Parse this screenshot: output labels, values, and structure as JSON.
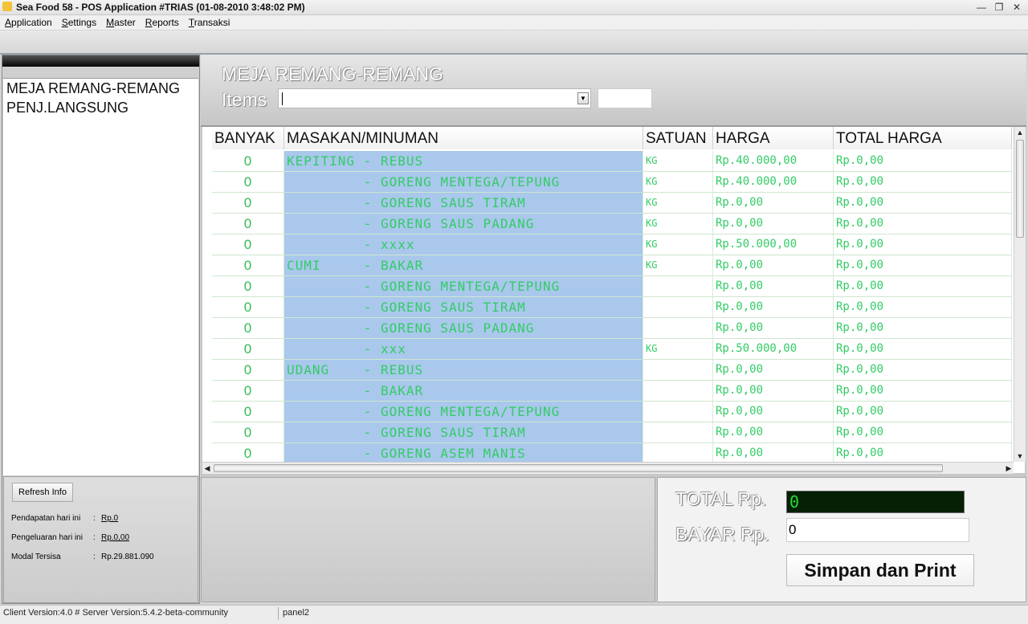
{
  "window": {
    "title": "Sea Food 58 - POS Application #TRIAS (01-08-2010 3:48:02 PM)"
  },
  "menu": [
    "Application",
    "Settings",
    "Master",
    "Reports",
    "Transaksi"
  ],
  "left_panel": {
    "tables": [
      "MEJA REMANG-REMANG",
      "PENJ.LANGSUNG"
    ],
    "refresh_label": "Refresh Info",
    "info": [
      {
        "label": "Pendapatan hari ini",
        "sep": ":",
        "value": "Rp.0"
      },
      {
        "label": "Pengeluaran hari ini",
        "sep": ":",
        "value": "Rp.0,00"
      },
      {
        "label": "Modal Tersisa",
        "sep": ":",
        "value": "Rp.29.881.090"
      }
    ]
  },
  "header": {
    "table_name": "MEJA REMANG-REMANG",
    "items_label": "Items",
    "items_value": "",
    "qty_value": ""
  },
  "grid": {
    "columns": [
      "BANYAK",
      "MASAKAN/MINUMAN",
      "SATUAN",
      "HARGA",
      "TOTAL HARGA"
    ],
    "rows": [
      {
        "qty": "0",
        "menu": "KEPITING - REBUS",
        "unit": "KG",
        "price": "Rp.40.000,00",
        "total": "Rp.0,00"
      },
      {
        "qty": "0",
        "menu": "         - GORENG MENTEGA/TEPUNG",
        "unit": "KG",
        "price": "Rp.40.000,00",
        "total": "Rp.0,00"
      },
      {
        "qty": "0",
        "menu": "         - GORENG SAUS TIRAM",
        "unit": "KG",
        "price": "Rp.0,00",
        "total": "Rp.0,00"
      },
      {
        "qty": "0",
        "menu": "         - GORENG SAUS PADANG",
        "unit": "KG",
        "price": "Rp.0,00",
        "total": "Rp.0,00"
      },
      {
        "qty": "0",
        "menu": "         - xxxx",
        "unit": "KG",
        "price": "Rp.50.000,00",
        "total": "Rp.0,00"
      },
      {
        "qty": "0",
        "menu": "CUMI     - BAKAR",
        "unit": "KG",
        "price": "Rp.0,00",
        "total": "Rp.0,00"
      },
      {
        "qty": "0",
        "menu": "         - GORENG MENTEGA/TEPUNG",
        "unit": "",
        "price": "Rp.0,00",
        "total": "Rp.0,00"
      },
      {
        "qty": "0",
        "menu": "         - GORENG SAUS TIRAM",
        "unit": "",
        "price": "Rp.0,00",
        "total": "Rp.0,00"
      },
      {
        "qty": "0",
        "menu": "         - GORENG SAUS PADANG",
        "unit": "",
        "price": "Rp.0,00",
        "total": "Rp.0,00"
      },
      {
        "qty": "0",
        "menu": "         - xxx",
        "unit": "KG",
        "price": "Rp.50.000,00",
        "total": "Rp.0,00"
      },
      {
        "qty": "0",
        "menu": "UDANG    - REBUS",
        "unit": "",
        "price": "Rp.0,00",
        "total": "Rp.0,00"
      },
      {
        "qty": "0",
        "menu": "         - BAKAR",
        "unit": "",
        "price": "Rp.0,00",
        "total": "Rp.0,00"
      },
      {
        "qty": "0",
        "menu": "         - GORENG MENTEGA/TEPUNG",
        "unit": "",
        "price": "Rp.0,00",
        "total": "Rp.0,00"
      },
      {
        "qty": "0",
        "menu": "         - GORENG SAUS TIRAM",
        "unit": "",
        "price": "Rp.0,00",
        "total": "Rp.0,00"
      },
      {
        "qty": "0",
        "menu": "         - GORENG ASEM MANIS",
        "unit": "",
        "price": "Rp.0,00",
        "total": "Rp.0,00"
      }
    ]
  },
  "payment": {
    "total_label": "TOTAL  Rp.",
    "total_value": "0",
    "bayar_label": "BAYAR  Rp.",
    "bayar_value": "0",
    "save_label": "Simpan dan Print"
  },
  "status": {
    "panel1": "Client Version:4.0 # Server Version:5.4.2-beta-community",
    "panel2": "panel2"
  },
  "colors": {
    "grid_text": "#33cc66",
    "menu_cell_bg": "#a9c8ec",
    "led_bg": "#052005",
    "led_text": "#22dd33"
  }
}
